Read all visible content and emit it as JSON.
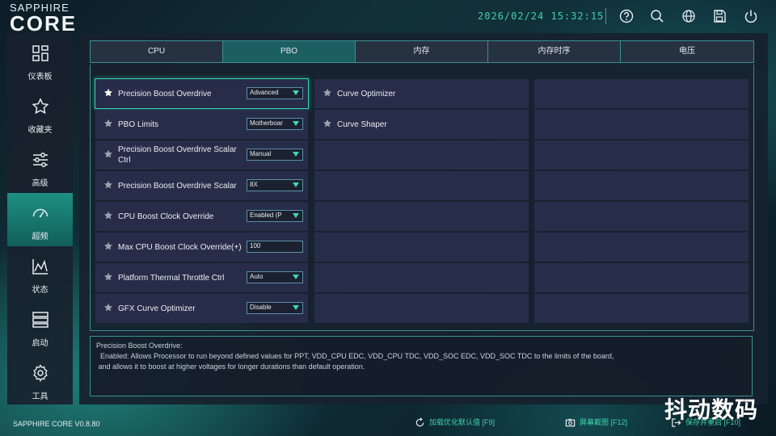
{
  "app": {
    "logo_top": "SAPPHIRE",
    "logo_main": "CORE",
    "datetime": "2026/02/24 15:32:15",
    "version": "SAPPHIRE CORE V0.8.80"
  },
  "top_icons": [
    "help-icon",
    "search-icon",
    "globe-icon",
    "save-icon",
    "power-icon"
  ],
  "sidebar": {
    "items": [
      {
        "label": "仪表板",
        "icon": "dashboard-icon",
        "active": false
      },
      {
        "label": "收藏夹",
        "icon": "star-icon",
        "active": false
      },
      {
        "label": "高级",
        "icon": "sliders-icon",
        "active": false
      },
      {
        "label": "超频",
        "icon": "gauge-icon",
        "active": true
      },
      {
        "label": "状态",
        "icon": "chart-icon",
        "active": false
      },
      {
        "label": "启动",
        "icon": "boot-icon",
        "active": false
      },
      {
        "label": "工具",
        "icon": "gear-icon",
        "active": false
      }
    ]
  },
  "tabs": [
    {
      "label": "CPU",
      "active": false
    },
    {
      "label": "PBO",
      "active": true
    },
    {
      "label": "内存",
      "active": false
    },
    {
      "label": "内存时序",
      "active": false
    },
    {
      "label": "电压",
      "active": false
    }
  ],
  "settings": [
    {
      "label": "Precision Boost Overdrive",
      "value": "Advanced",
      "kind": "select",
      "starred": true,
      "selected": true
    },
    {
      "label": "PBO Limits",
      "value": "Motherboar",
      "kind": "select",
      "starred": false,
      "selected": false
    },
    {
      "label": "Precision Boost Overdrive Scalar Ctrl",
      "value": "Manual",
      "kind": "select",
      "starred": false,
      "selected": false
    },
    {
      "label": "Precision Boost Overdrive Scalar",
      "value": "8X",
      "kind": "select",
      "starred": false,
      "selected": false
    },
    {
      "label": "CPU Boost Clock Override",
      "value": "Enabled (P",
      "kind": "select",
      "starred": false,
      "selected": false
    },
    {
      "label": "Max CPU Boost Clock Override(+)",
      "value": "100",
      "kind": "input",
      "starred": false,
      "selected": false
    },
    {
      "label": "Platform Thermal Throttle Ctrl",
      "value": "Auto",
      "kind": "select",
      "starred": false,
      "selected": false
    },
    {
      "label": "GFX Curve Optimizer",
      "value": "Disable",
      "kind": "select",
      "starred": false,
      "selected": false
    }
  ],
  "submenus": [
    {
      "label": "Curve Optimizer",
      "starred": false
    },
    {
      "label": "Curve Shaper",
      "starred": false
    }
  ],
  "description": {
    "title": "Precision Boost Overdrive:",
    "line1": "  Enabled: Allows Processor to run beyond defined values for PPT, VDD_CPU EDC, VDD_CPU TDC, VDD_SOC EDC, VDD_SOC TDC to the limits of the board,",
    "line2": " and allows it to boost at higher voltages for longer durations than default operation."
  },
  "bottom_actions": [
    {
      "label": "加载优化默认值 [F9]",
      "icon": "reset-icon"
    },
    {
      "label": "屏幕截图 [F12]",
      "icon": "camera-icon"
    },
    {
      "label": "保存并重启 [F10]",
      "icon": "exit-icon"
    }
  ],
  "watermark": "抖动数码",
  "colors": {
    "accent": "#3fd2a8",
    "panel": "#272d49",
    "border": "#3a8f94",
    "active_nav": "#1e8f82"
  }
}
